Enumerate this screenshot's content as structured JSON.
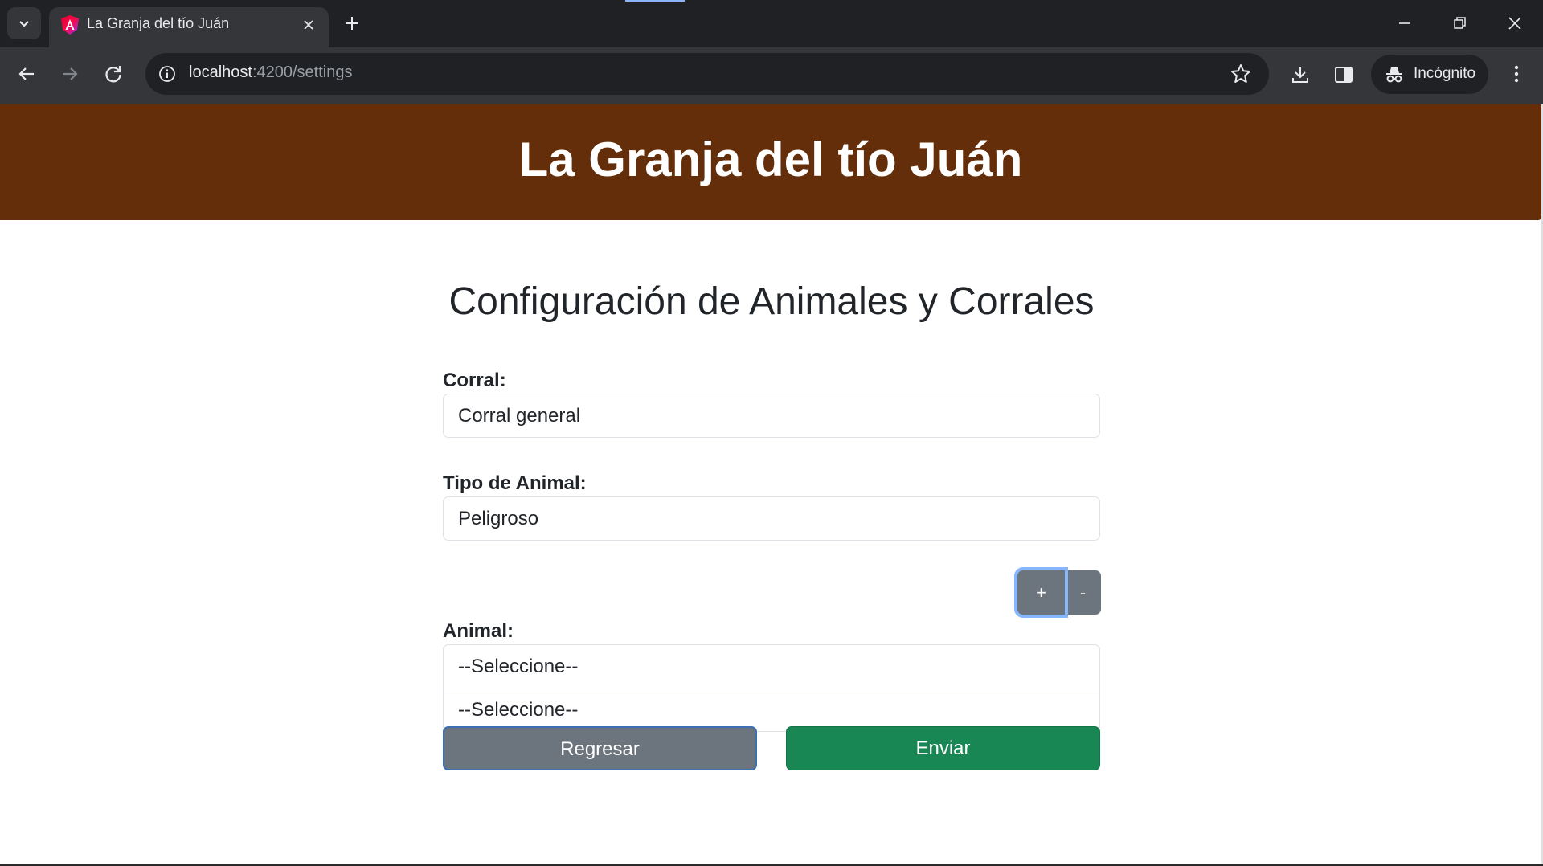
{
  "browser": {
    "tab": {
      "title": "La Granja del tío Juán",
      "favicon": "angular-icon"
    },
    "url": {
      "host": "localhost",
      "path": ":4200/settings"
    },
    "profile_label": "Incógnito",
    "icons": {
      "tab_search": "chevron-down-icon",
      "close_tab": "close-icon",
      "new_tab": "plus-icon",
      "back": "arrow-left-icon",
      "forward": "arrow-right-icon",
      "reload": "reload-icon",
      "site_info": "info-icon",
      "bookmark": "star-icon",
      "downloads": "download-icon",
      "side_panel": "side-panel-icon",
      "incognito": "incognito-icon",
      "menu": "kebab-menu-icon",
      "minimize": "minimize-icon",
      "restore": "restore-icon",
      "close_window": "close-icon"
    }
  },
  "app": {
    "title": "La Granja del tío Juán",
    "header_color": "#632e09"
  },
  "form": {
    "title": "Configuración de Animales y Corrales",
    "corral": {
      "label": "Corral:",
      "value": "Corral general"
    },
    "tipo": {
      "label": "Tipo de Animal:",
      "value": "Peligroso"
    },
    "add_button": "+",
    "remove_button": "-",
    "animal": {
      "label": "Animal:",
      "selects": [
        {
          "value": "--Seleccione--"
        },
        {
          "value": "--Seleccione--"
        }
      ]
    },
    "back_button": "Regresar",
    "submit_button": "Enviar",
    "colors": {
      "secondary": "#6c757d",
      "success": "#198754",
      "focus_ring": "#86b7fe"
    }
  }
}
